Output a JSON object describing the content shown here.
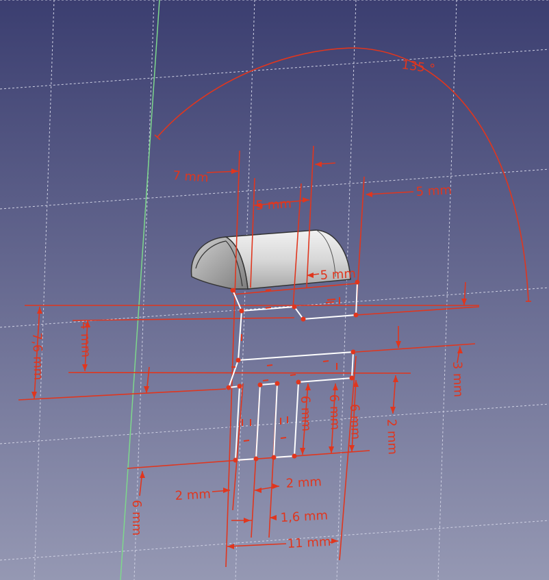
{
  "colors": {
    "background_top": "#3b3e70",
    "background_bottom": "#9598b3",
    "grid": "#d0d2e4",
    "constraint": "#e0361e",
    "sketch_geometry": "#ffffff",
    "axis_green": "#7ed88c",
    "solid_light": "#e4e4e4",
    "solid_dark": "#8a8a8a"
  },
  "dimensions": {
    "angle_135": "135 °",
    "d_7mm": "7 mm",
    "d_5mm_a": "5 mm",
    "d_5mm_b": "5 mm",
    "d_5mm_c": "5 mm",
    "d_7_6mm": "7,6 mm",
    "d_4mm": "4 mm",
    "d_3mm": "3 mm",
    "d_6mm_a": "6 mm",
    "d_6mm_b": "6 mm",
    "d_6mm_c": "6 mm",
    "d_2mm_a": "2 mm",
    "d_2mm_b": "2 mm",
    "d_2mm_c": "2 mm",
    "d_1_6mm": "1,6 mm",
    "d_11mm": "11 mm",
    "d_6mm_d": "6 mm"
  }
}
